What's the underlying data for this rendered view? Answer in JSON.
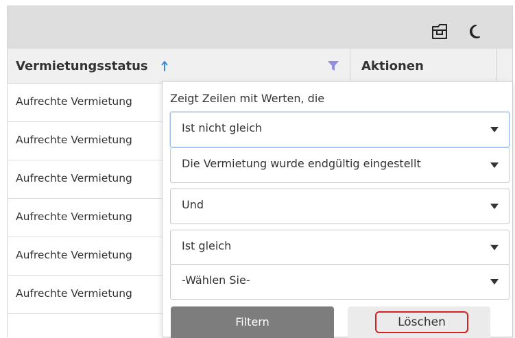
{
  "toolbar": {
    "icons": [
      "export-icon",
      "dark-mode-moon-icon"
    ]
  },
  "table": {
    "columns": [
      {
        "label": "Vermietungsstatus",
        "sort": "ascending",
        "filter_active": true
      },
      {
        "label": "Aktionen"
      }
    ],
    "rows": [
      "Aufrechte Vermietung",
      "Aufrechte Vermietung",
      "Aufrechte Vermietung",
      "Aufrechte Vermietung",
      "Aufrechte Vermietung",
      "Aufrechte Vermietung"
    ]
  },
  "filter_popup": {
    "title": "Zeigt Zeilen mit Werten, die",
    "condition1_operator": "Ist nicht gleich",
    "condition1_value": "Die Vermietung wurde endgültig eingestellt",
    "logic": "Und",
    "condition2_operator": "Ist gleich",
    "condition2_value": "-Wählen Sie-",
    "filter_button": "Filtern",
    "clear_button": "Löschen"
  },
  "colors": {
    "filter_icon": "#8f8ee0",
    "sort_icon": "#3c8ad6",
    "clear_highlight": "#d81e1e",
    "filter_button_bg": "#7d7d7d"
  }
}
